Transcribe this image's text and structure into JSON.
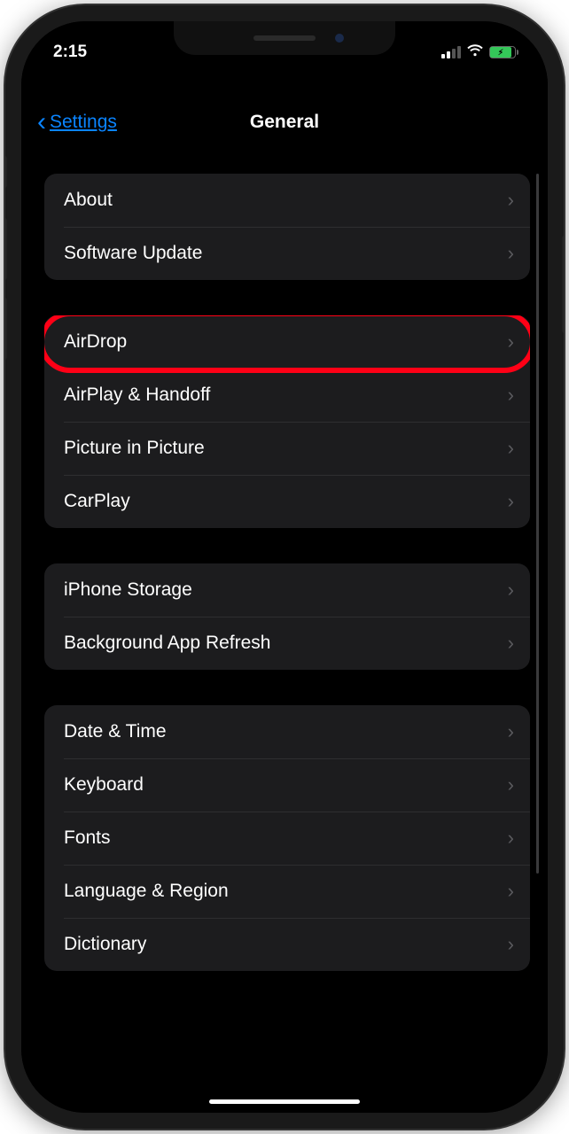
{
  "status": {
    "time": "2:15"
  },
  "nav": {
    "back_label": "Settings",
    "title": "General"
  },
  "groups": [
    {
      "rows": [
        {
          "label": "About",
          "id": "about"
        },
        {
          "label": "Software Update",
          "id": "software-update"
        }
      ]
    },
    {
      "rows": [
        {
          "label": "AirDrop",
          "id": "airdrop",
          "highlighted": true
        },
        {
          "label": "AirPlay & Handoff",
          "id": "airplay-handoff"
        },
        {
          "label": "Picture in Picture",
          "id": "picture-in-picture"
        },
        {
          "label": "CarPlay",
          "id": "carplay"
        }
      ]
    },
    {
      "rows": [
        {
          "label": "iPhone Storage",
          "id": "iphone-storage"
        },
        {
          "label": "Background App Refresh",
          "id": "background-app-refresh"
        }
      ]
    },
    {
      "rows": [
        {
          "label": "Date & Time",
          "id": "date-time"
        },
        {
          "label": "Keyboard",
          "id": "keyboard"
        },
        {
          "label": "Fonts",
          "id": "fonts"
        },
        {
          "label": "Language & Region",
          "id": "language-region"
        },
        {
          "label": "Dictionary",
          "id": "dictionary"
        }
      ]
    }
  ]
}
